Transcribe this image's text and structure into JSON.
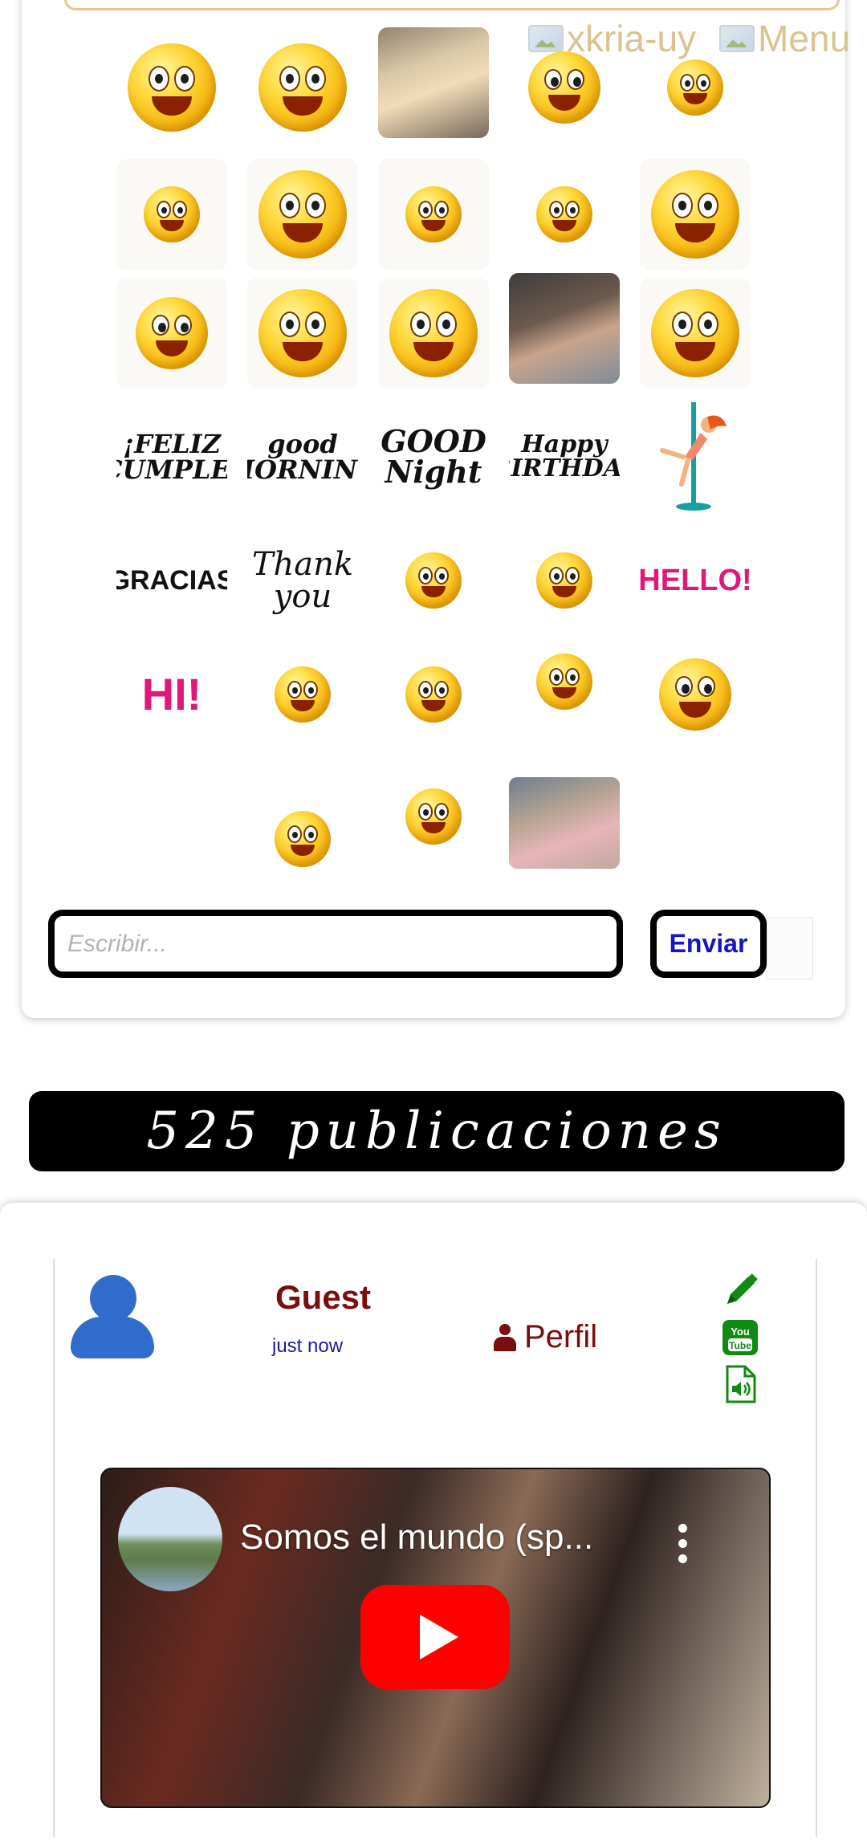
{
  "header": {
    "logo_alt": "xkria-uy",
    "menu_alt": "Menu"
  },
  "stickers": {
    "feliz_cumple": "¡FELIZ CUMPLE!",
    "good_morning": "good MORNING",
    "good_night": "GOOD Night",
    "happy_birthday": "Happy BIRTHDAY",
    "gracias": "GRACIAS",
    "thank_you": "Thank you",
    "hello": "HELLO!",
    "hi": "HI!"
  },
  "composer": {
    "placeholder": "Escribir...",
    "send_label": "Enviar"
  },
  "counter": {
    "text": "525 publicaciones"
  },
  "post": {
    "author": "Guest",
    "time": "just now",
    "profile_label": "Perfil",
    "video_title": "Somos el mundo (sp..."
  },
  "colors": {
    "brand_dark_red": "#7a0d0d",
    "link_blue": "#1a1aa6",
    "send_blue": "#1414c8",
    "icon_green": "#118a11",
    "youtube_red": "#ff0000"
  }
}
